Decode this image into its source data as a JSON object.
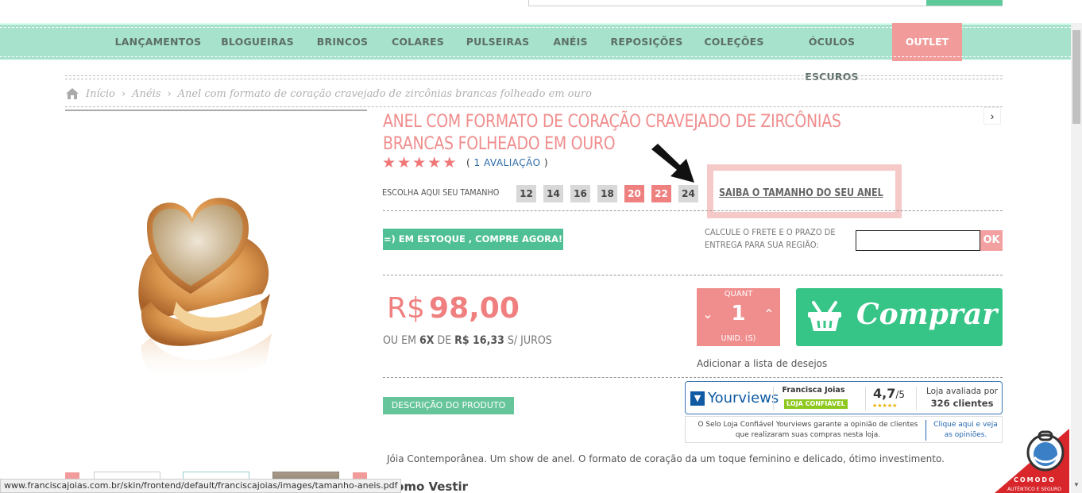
{
  "nav": {
    "items": [
      "LANÇAMENTOS",
      "BLOGUEIRAS",
      "BRINCOS",
      "COLARES",
      "PULSEIRAS",
      "ANÉIS",
      "REPOSIÇÕES",
      "COLEÇÕES",
      "ÓCULOS ESCUROS"
    ],
    "outlet": "OUTLET"
  },
  "breadcrumb": {
    "home": "Início",
    "category": "Anéis",
    "current": "Anel com formato de coração cravejado de zircônias brancas folheado em ouro",
    "separator": "›"
  },
  "product": {
    "title": "ANEL COM FORMATO DE CORAÇÃO CRAVEJADO DE ZIRCÔNIAS BRANCAS FOLHEADO EM OURO",
    "rating_stars": 5,
    "reviews_count": "1 AVALIAÇÃO",
    "size_label": "ESCOLHA AQUI SEU TAMANHO",
    "sizes": [
      {
        "label": "12",
        "available": true
      },
      {
        "label": "14",
        "available": true
      },
      {
        "label": "16",
        "available": true
      },
      {
        "label": "18",
        "available": true
      },
      {
        "label": "20",
        "available": false
      },
      {
        "label": "22",
        "available": false
      },
      {
        "label": "24",
        "available": true
      }
    ],
    "size_guide": "SAIBA O TAMANHO DO SEU ANEL",
    "stock_button": "=) EM ESTOQUE , COMPRE AGORA!",
    "freight_label": "CALCULE O FRETE E O PRAZO DE ENTREGA PARA SUA REGIÃO:",
    "freight_placeholder": "",
    "freight_ok": "OK",
    "price_currency": "R$",
    "price_value": "98,00",
    "installments_prefix": "OU EM",
    "installments_count": "6X",
    "installments_mid": "DE",
    "installments_value": "R$ 16,33",
    "installments_suffix": "S/ JUROS",
    "qty_label": "QUANT",
    "qty_value": "1",
    "qty_unit": "UNID. (S)",
    "buy_label": "Comprar",
    "wishlist": "Adicionar a lista de desejos",
    "desc_tab": "DESCRIÇÃO DO PRODUTO",
    "description": "Jóia Contemporânea. Um show de anel. O formato de coração da um toque feminino e delicado, ótimo investimento.",
    "how_to_wear": "Como Vestir"
  },
  "yourviews": {
    "brand": "Yourviews",
    "store": "Francisca Joias",
    "badge": "LOJA CONFIÁVEL",
    "score": "4,7",
    "score_of": "/5",
    "rated_by": "Loja avaliada por",
    "clients": "326 clientes",
    "note": "O Selo Loja Confiável Yourviews garante a opinião de clientes que realizaram suas compras nesta loja.",
    "note_link": "Clique aqui e veja as opiniões."
  },
  "status_bar": "www.franciscajoias.com.br/skin/frontend/default/franciscajoias/images/tamanho-aneis.pdf",
  "comodo": {
    "label": "COMODO",
    "sub": "AUTÊNTICO E SEGURO"
  },
  "colors": {
    "nav_bg": "#a6e2cc",
    "accent_pink": "#f08d8d",
    "accent_green": "#37c487"
  }
}
